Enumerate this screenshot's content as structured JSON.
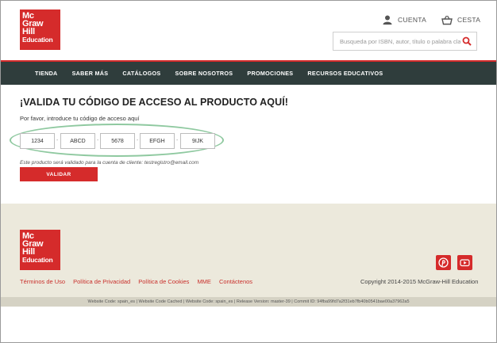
{
  "header": {
    "logo_lines": [
      "Mc",
      "Graw",
      "Hill",
      "Education"
    ],
    "account_label": "CUENTA",
    "cart_label": "CESTA",
    "search_placeholder": "Busqueda por ISBN, autor, título o palabra clave"
  },
  "nav": {
    "items": [
      "TIENDA",
      "SABER MÁS",
      "CATÁLOGOS",
      "SOBRE NOSOTROS",
      "PROMOCIONES",
      "RECURSOS EDUCATIVOS"
    ]
  },
  "main": {
    "title": "¡VALIDA TU CÓDIGO DE ACCESO AL PRODUCTO AQUÍ!",
    "prompt": "Por favor, introduce tu código de acceso aquí",
    "codes": [
      "1234",
      "ABCD",
      "5678",
      "EFGH",
      "9IJK"
    ],
    "separator": "-",
    "note": "Este producto será validado para la cuenta de cliente: testregistro@email.com",
    "validate_label": "VALIDAR"
  },
  "footer": {
    "links": [
      "Términos de Uso",
      "Política de Privacidad",
      "Política de Cookies",
      "MME",
      "Contáctenos"
    ],
    "copyright": "Copyright 2014-2015 McGraw-Hill Education",
    "build_info": "Website Code: spain_es | Website Code Cached | Website Code: spain_es | Release Version: master-39 | Commit ID: 94fba99fd7a2f31eb7fb40b0541bae00a37962a5"
  },
  "colors": {
    "brand_red": "#d52b2b",
    "nav_bg": "#2f3d3c",
    "footer_bg": "#ece9dc",
    "highlight_ellipse": "#8fc9a0"
  }
}
